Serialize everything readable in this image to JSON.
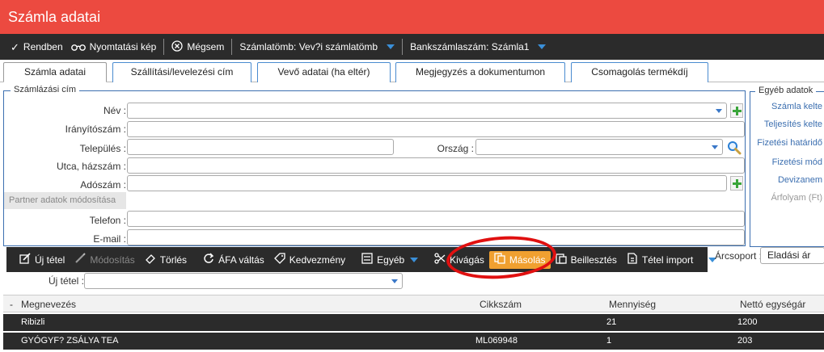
{
  "window": {
    "title": "Számla adatai"
  },
  "toolbar": {
    "ok_label": "Rendben",
    "print_label": "Nyomtatási kép",
    "cancel_label": "Mégsem",
    "block_label": "Számlatömb: Vev?i számlatömb",
    "bank_label": "Bankszámlaszám: Számla1"
  },
  "tabs": [
    {
      "label": "Számla adatai",
      "active": true
    },
    {
      "label": "Szállítási/levelezési cím",
      "active": false
    },
    {
      "label": "Vevő adatai (ha eltér)",
      "active": false
    },
    {
      "label": "Megjegyzés a dokumentumon",
      "active": false
    },
    {
      "label": "Csomagolás termékdíj",
      "active": false
    }
  ],
  "billing": {
    "legend": "Számlázási cím",
    "name_label": "Név :",
    "zip_label": "Irányítószám :",
    "city_label": "Település :",
    "country_label": "Ország :",
    "street_label": "Utca, házszám :",
    "tax_label": "Adószám :",
    "partner_btn": "Partner adatok módosítása",
    "phone_label": "Telefon :",
    "email_label": "E-mail :"
  },
  "other": {
    "legend": "Egyéb adatok",
    "items": [
      "Számla kelte",
      "Teljesítés kelte",
      "Fizetési határidő",
      "Fizetési mód",
      "Devizanem",
      "Árfolyam (Ft)"
    ]
  },
  "items_toolbar": {
    "new_label": "Új tétel",
    "edit_label": "Módosítás",
    "delete_label": "Törlés",
    "vat_label": "ÁFA váltás",
    "discount_label": "Kedvezmény",
    "other_label": "Egyéb",
    "cut_label": "Kivágás",
    "copy_label": "Másolás",
    "paste_label": "Beillesztés",
    "import_label": "Tétel import"
  },
  "price_group": {
    "label": "Árcsoport :",
    "value": "Eladási ár"
  },
  "new_item": {
    "label": "Új tétel :"
  },
  "table": {
    "collapse": "-",
    "headers": [
      "Megnevezés",
      "Cikkszám",
      "Mennyiség",
      "Nettó egységár"
    ],
    "rows": [
      {
        "name": "Ribizli",
        "sku": "",
        "qty": "21",
        "price": "1200"
      },
      {
        "name": "GYÓGYF? ZSÁLYA TEA",
        "sku": "ML069948",
        "qty": "1",
        "price": "203"
      }
    ]
  },
  "colors": {
    "title_bar": "#ec4a40",
    "toolbar": "#2b2b2b",
    "accent": "#3a78c8",
    "active_button": "#f0a030",
    "highlight": "#e01010"
  }
}
